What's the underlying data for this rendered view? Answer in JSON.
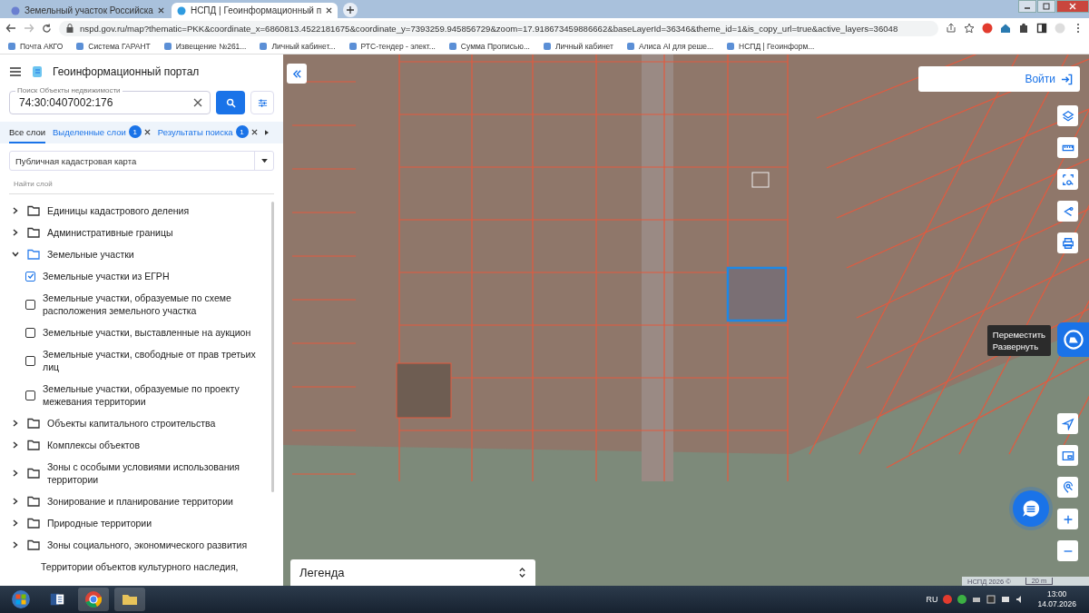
{
  "browser": {
    "tabs": [
      {
        "title": "Земельный участок Российска",
        "selected": false
      },
      {
        "title": "НСПД | Геоинформационный п",
        "selected": true
      }
    ],
    "url": "nspd.gov.ru/map?thematic=PKK&coordinate_x=6860813.4522181675&coordinate_y=7393259.945856729&zoom=17.918673459886662&baseLayerId=36346&theme_id=1&is_copy_url=true&active_layers=36048",
    "bookmarks": [
      "Почта АКГО",
      "Система ГАРАНТ",
      "Извещение №261...",
      "Личный кабинет...",
      "РТС-тендер - элект...",
      "Сумма Прописью...",
      "Личный кабинет",
      "Алиса AI для реше...",
      "НСПД | Геоинформ..."
    ]
  },
  "portal": {
    "title": "Геоинформационный портал",
    "search": {
      "label": "Поиск Объекты недвижимости",
      "value": "74:30:0407002:176"
    },
    "layer_tabs": [
      {
        "label": "Все слои",
        "selected": true
      },
      {
        "label": "Выделенные слои",
        "count": "1",
        "selected": false
      },
      {
        "label": "Результаты поиска",
        "count": "1",
        "selected": false
      }
    ],
    "basemap": "Публичная кадастровая карта",
    "layer_filter": {
      "placeholder": "Найти слой"
    },
    "layers": [
      {
        "kind": "group",
        "label": "Единицы кадастрового деления",
        "expanded": false
      },
      {
        "kind": "group",
        "label": "Административные границы",
        "expanded": false
      },
      {
        "kind": "group",
        "label": "Земельные участки",
        "expanded": true,
        "children": [
          {
            "kind": "layer",
            "label": "Земельные участки из ЕГРН",
            "checked": true
          },
          {
            "kind": "layer",
            "label": "Земельные участки, образуемые по схеме расположения земельного участка",
            "checked": false
          },
          {
            "kind": "layer",
            "label": "Земельные участки, выставленные на аукцион",
            "checked": false
          },
          {
            "kind": "layer",
            "label": "Земельные участки, свободные от прав третьих лиц",
            "checked": false
          },
          {
            "kind": "layer",
            "label": "Земельные участки, образуемые по проекту межевания территории",
            "checked": false
          }
        ]
      },
      {
        "kind": "group",
        "label": "Объекты капитального строительства",
        "expanded": false
      },
      {
        "kind": "group",
        "label": "Комплексы объектов",
        "expanded": false
      },
      {
        "kind": "group",
        "label": "Зоны с особыми условиями использования территории",
        "expanded": false
      },
      {
        "kind": "group",
        "label": "Зонирование и планирование территории",
        "expanded": false
      },
      {
        "kind": "group",
        "label": "Природные территории",
        "expanded": false
      },
      {
        "kind": "group",
        "label": "Зоны социального, экономического развития",
        "expanded": false
      },
      {
        "kind": "partial",
        "label": "Территории объектов культурного наследия,"
      }
    ]
  },
  "map": {
    "login": "Войти",
    "tooltip": [
      "Переместить",
      "Развернуть"
    ],
    "legend": "Легенда",
    "attribution": "НСПД 2026 ©",
    "scale": "20 m"
  },
  "taskbar": {
    "language": "RU",
    "time": "13:00",
    "date": "14.07.2026"
  }
}
